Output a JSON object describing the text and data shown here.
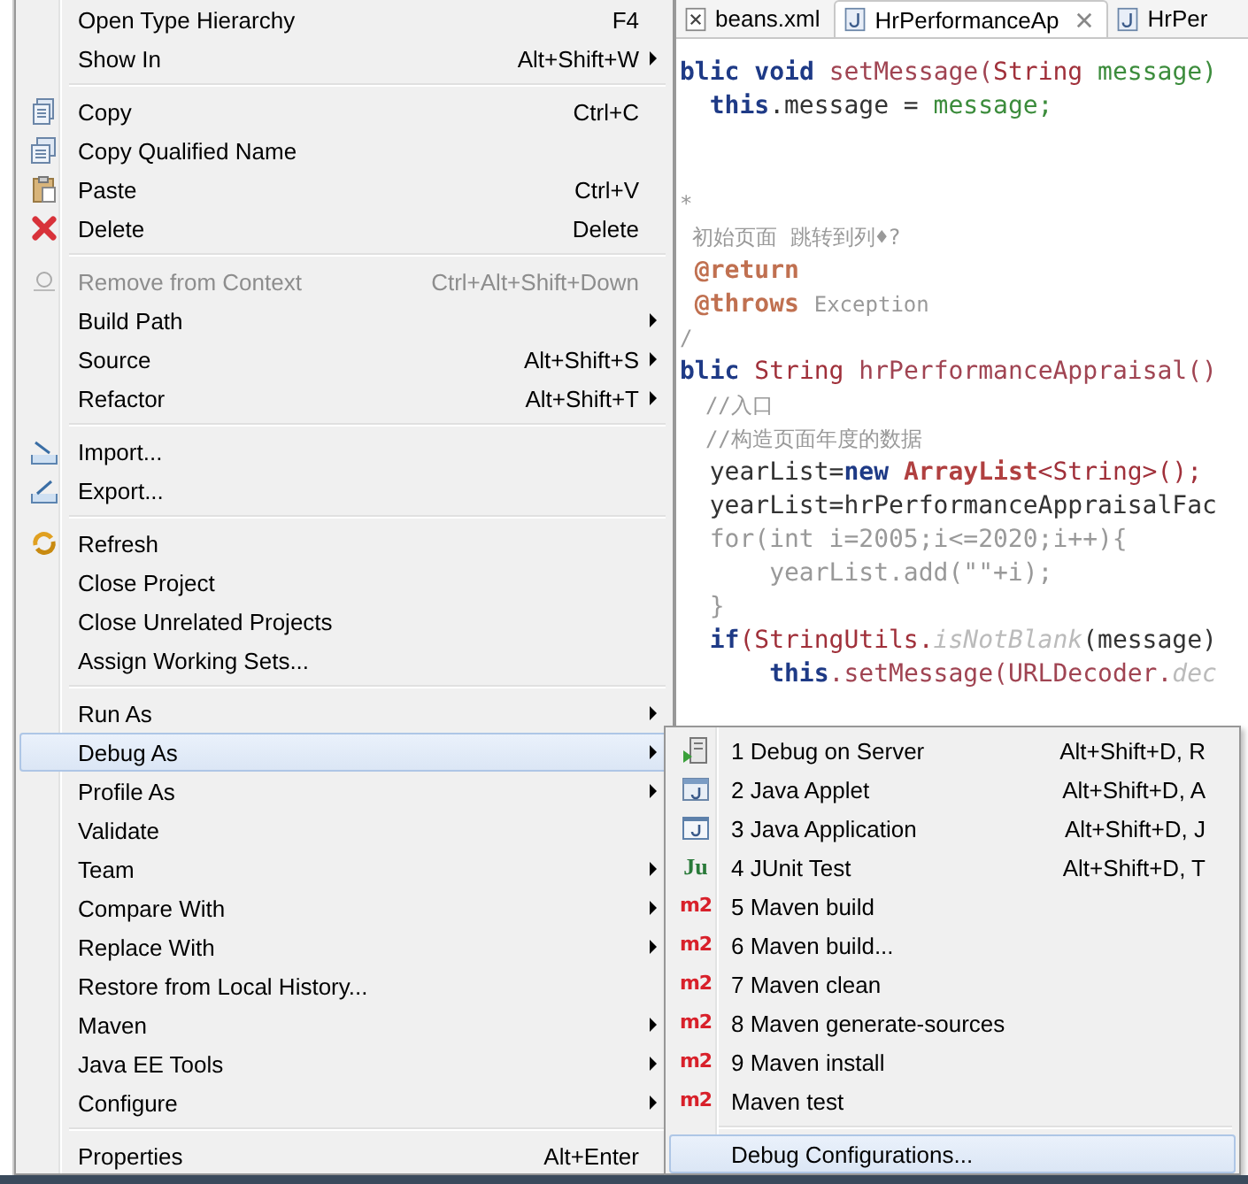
{
  "editor": {
    "tabs": [
      {
        "label": "beans.xml",
        "selected": false,
        "closable": false
      },
      {
        "label": "HrPerformanceAp",
        "selected": true,
        "closable": true
      },
      {
        "label": "HrPer",
        "selected": false,
        "closable": false
      }
    ],
    "code_lines": [
      [
        {
          "t": "blic ",
          "kind": "kw"
        },
        {
          "t": "void ",
          "kind": "kw"
        },
        {
          "t": "setMessage(",
          "kind": "method"
        },
        {
          "t": "String ",
          "kind": "type"
        },
        {
          "t": "message)",
          "kind": "param"
        }
      ],
      [
        {
          "t": "  this",
          "kind": "kw"
        },
        {
          "t": ".message = ",
          "kind": "plain"
        },
        {
          "t": "message;",
          "kind": "param"
        }
      ],
      [
        {
          "t": "*",
          "kind": "comment"
        }
      ],
      [
        {
          "t": " 初始页面 跳转到列♦?",
          "kind": "comment"
        }
      ],
      [
        {
          "t": " @return",
          "kind": "tag"
        }
      ],
      [
        {
          "t": " @throws ",
          "kind": "tag"
        },
        {
          "t": "Exception",
          "kind": "comment"
        }
      ],
      [
        {
          "t": "/",
          "kind": "comment"
        }
      ],
      [
        {
          "t": "blic ",
          "kind": "kw"
        },
        {
          "t": "String ",
          "kind": "type"
        },
        {
          "t": "hrPerformanceAppraisal()",
          "kind": "method"
        }
      ],
      [
        {
          "t": "  //入口",
          "kind": "comment"
        }
      ],
      [
        {
          "t": "  //构造页面年度的数据",
          "kind": "comment"
        }
      ],
      [
        {
          "t": "  yearList=",
          "kind": "plain"
        },
        {
          "t": "new ",
          "kind": "kw"
        },
        {
          "t": "ArrayList",
          "kind": "classbold"
        },
        {
          "t": "<String>();",
          "kind": "type"
        }
      ],
      [
        {
          "t": "  yearList=hrPerformanceAppraisalFac",
          "kind": "plain"
        }
      ],
      [
        {
          "t": "  for(int i=2005;i<=2020;i++){",
          "kind": "dim"
        }
      ],
      [
        {
          "t": "      yearList.add(\"\"+i);",
          "kind": "dim"
        }
      ],
      [
        {
          "t": "  }",
          "kind": "dim"
        }
      ],
      [
        {
          "t": "  if",
          "kind": "kw"
        },
        {
          "t": "(StringUtils.",
          "kind": "type"
        },
        {
          "t": "isNotBlank",
          "kind": "static"
        },
        {
          "t": "(message)",
          "kind": "plain"
        }
      ],
      [
        {
          "t": "      this",
          "kind": "kw"
        },
        {
          "t": ".setMessage(URLDecoder.",
          "kind": "method"
        },
        {
          "t": "dec",
          "kind": "static"
        }
      ]
    ]
  },
  "context_menu": {
    "items": [
      {
        "kind": "item",
        "label": "Open Type Hierarchy",
        "shortcut": "F4",
        "submenu": false,
        "disabled": false,
        "selected": false
      },
      {
        "kind": "item",
        "label": "Show In",
        "shortcut": "Alt+Shift+W",
        "submenu": true,
        "disabled": false,
        "selected": false
      },
      {
        "kind": "separator"
      },
      {
        "kind": "item",
        "label": "Copy",
        "shortcut": "Ctrl+C",
        "submenu": false,
        "disabled": false,
        "selected": false
      },
      {
        "kind": "item",
        "label": "Copy Qualified Name",
        "submenu": false,
        "disabled": false,
        "selected": false
      },
      {
        "kind": "item",
        "label": "Paste",
        "shortcut": "Ctrl+V",
        "submenu": false,
        "disabled": false,
        "selected": false
      },
      {
        "kind": "item",
        "label": "Delete",
        "shortcut": "Delete",
        "submenu": false,
        "disabled": false,
        "selected": false
      },
      {
        "kind": "separator"
      },
      {
        "kind": "item",
        "label": "Remove from Context",
        "shortcut": "Ctrl+Alt+Shift+Down",
        "submenu": false,
        "disabled": true,
        "selected": false
      },
      {
        "kind": "item",
        "label": "Build Path",
        "submenu": true,
        "disabled": false,
        "selected": false
      },
      {
        "kind": "item",
        "label": "Source",
        "shortcut": "Alt+Shift+S",
        "submenu": true,
        "disabled": false,
        "selected": false
      },
      {
        "kind": "item",
        "label": "Refactor",
        "shortcut": "Alt+Shift+T",
        "submenu": true,
        "disabled": false,
        "selected": false
      },
      {
        "kind": "separator"
      },
      {
        "kind": "item",
        "label": "Import...",
        "submenu": false,
        "disabled": false,
        "selected": false
      },
      {
        "kind": "item",
        "label": "Export...",
        "submenu": false,
        "disabled": false,
        "selected": false
      },
      {
        "kind": "separator"
      },
      {
        "kind": "item",
        "label": "Refresh",
        "submenu": false,
        "disabled": false,
        "selected": false
      },
      {
        "kind": "item",
        "label": "Close Project",
        "submenu": false,
        "disabled": false,
        "selected": false
      },
      {
        "kind": "item",
        "label": "Close Unrelated Projects",
        "submenu": false,
        "disabled": false,
        "selected": false
      },
      {
        "kind": "item",
        "label": "Assign Working Sets...",
        "submenu": false,
        "disabled": false,
        "selected": false
      },
      {
        "kind": "separator"
      },
      {
        "kind": "item",
        "label": "Run As",
        "submenu": true,
        "disabled": false,
        "selected": false
      },
      {
        "kind": "item",
        "label": "Debug As",
        "submenu": true,
        "disabled": false,
        "selected": true
      },
      {
        "kind": "item",
        "label": "Profile As",
        "submenu": true,
        "disabled": false,
        "selected": false
      },
      {
        "kind": "item",
        "label": "Validate",
        "submenu": false,
        "disabled": false,
        "selected": false
      },
      {
        "kind": "item",
        "label": "Team",
        "submenu": true,
        "disabled": false,
        "selected": false
      },
      {
        "kind": "item",
        "label": "Compare With",
        "submenu": true,
        "disabled": false,
        "selected": false
      },
      {
        "kind": "item",
        "label": "Replace With",
        "submenu": true,
        "disabled": false,
        "selected": false
      },
      {
        "kind": "item",
        "label": "Restore from Local History...",
        "submenu": false,
        "disabled": false,
        "selected": false
      },
      {
        "kind": "item",
        "label": "Maven",
        "submenu": true,
        "disabled": false,
        "selected": false
      },
      {
        "kind": "item",
        "label": "Java EE Tools",
        "submenu": true,
        "disabled": false,
        "selected": false
      },
      {
        "kind": "item",
        "label": "Configure",
        "submenu": true,
        "disabled": false,
        "selected": false
      },
      {
        "kind": "separator"
      },
      {
        "kind": "item",
        "label": "Properties",
        "shortcut": "Alt+Enter",
        "submenu": false,
        "disabled": false,
        "selected": false
      }
    ]
  },
  "debug_submenu": {
    "items": [
      {
        "kind": "item",
        "label": "1 Debug on Server",
        "shortcut": "Alt+Shift+D, R",
        "selected": false
      },
      {
        "kind": "item",
        "label": "2 Java Applet",
        "shortcut": "Alt+Shift+D, A",
        "selected": false
      },
      {
        "kind": "item",
        "label": "3 Java Application",
        "shortcut": "Alt+Shift+D, J",
        "selected": false
      },
      {
        "kind": "item",
        "label": "4 JUnit Test",
        "shortcut": "Alt+Shift+D, T",
        "icon_text": "Ju",
        "selected": false
      },
      {
        "kind": "item",
        "label": "5 Maven build",
        "icon_text": "m2",
        "selected": false
      },
      {
        "kind": "item",
        "label": "6 Maven build...",
        "icon_text": "m2",
        "selected": false
      },
      {
        "kind": "item",
        "label": "7 Maven clean",
        "icon_text": "m2",
        "selected": false
      },
      {
        "kind": "item",
        "label": "8 Maven generate-sources",
        "icon_text": "m2",
        "selected": false
      },
      {
        "kind": "item",
        "label": "9 Maven install",
        "icon_text": "m2",
        "selected": false
      },
      {
        "kind": "item",
        "label": "Maven test",
        "icon_text": "m2",
        "selected": false
      },
      {
        "kind": "separator"
      },
      {
        "kind": "item",
        "label": "Debug Configurations...",
        "selected": true
      }
    ]
  }
}
